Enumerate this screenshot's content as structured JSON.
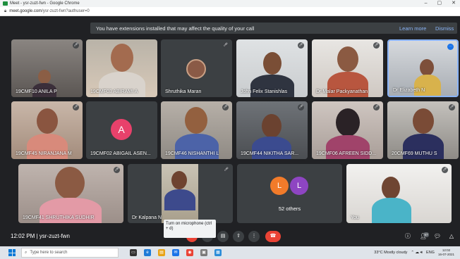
{
  "window": {
    "title": "Meet - ysr-zuzt-fwn - Google Chrome",
    "url_host": "meet.google.com",
    "url_path": "/ysr-zuzt-fwn?authuser=0",
    "controls": {
      "minimize": "–",
      "maximize": "▢",
      "close": "✕"
    }
  },
  "banner": {
    "message": "You have extensions installed that may affect the quality of your call",
    "learn_more": "Learn more",
    "dismiss": "Dismiss"
  },
  "tiles": [
    {
      "name": "19CMF10 ANILA P"
    },
    {
      "name": "19CMF03 ABIRAMI A"
    },
    {
      "name": "Shruthika Maran"
    },
    {
      "name": "John Felix Stanishlas"
    },
    {
      "name": "Dr Malar Packyanathan"
    },
    {
      "name": "Dr Elizabeth N"
    },
    {
      "name": "19CMF45 NIRANJANA M"
    },
    {
      "name": "19CMF02 ABIGAIL ASEN...",
      "initial": "A"
    },
    {
      "name": "19CMF46 NISHANTHI L"
    },
    {
      "name": "19CMF44 NIKITHA SAR..."
    },
    {
      "name": "19CMF06 AFREEN SIDD..."
    },
    {
      "name": "20CMF69 MUTHU S"
    },
    {
      "name": "19CMF41 SHRUTHIKA SUDHIR"
    },
    {
      "name": "Dr Kalpana N"
    },
    {
      "name": "52 others",
      "initials": [
        "L",
        "L"
      ]
    },
    {
      "name": "You"
    }
  ],
  "tooltip": "Turn on microphone (ctrl + d)",
  "bottombar": {
    "clock": "12:02 PM",
    "meeting_code": "ysr-zuzt-fwn",
    "participants_count": "57"
  },
  "taskbar": {
    "search_placeholder": "Type here to search",
    "weather": "33°C  Mostly cloudy",
    "lang": "ENG",
    "time": "12:02",
    "date": "16-07-2021"
  },
  "colors": {
    "meet_bg": "#202124",
    "tile_bg": "#3c4043",
    "end_call": "#ea4335",
    "link": "#8ab4f8",
    "avatar_a": "#e8416b",
    "avatar_l1": "#f27b2a",
    "avatar_l2": "#8e45c2"
  }
}
